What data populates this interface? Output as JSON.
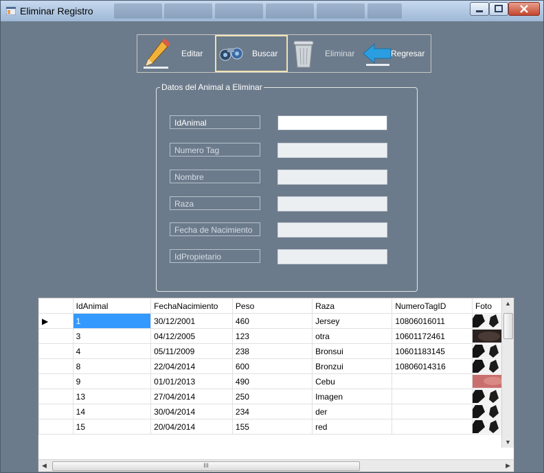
{
  "window": {
    "title": "Eliminar Registro",
    "icon": "form-icon"
  },
  "toolbar": [
    {
      "label": "Editar",
      "icon": "pencil-icon"
    },
    {
      "label": "Buscar",
      "icon": "binoculars-icon"
    },
    {
      "label": "Eliminar",
      "icon": "trash-icon"
    },
    {
      "label": "Regresar",
      "icon": "arrow-left-icon"
    }
  ],
  "group": {
    "title": "Datos del Animal a Eliminar",
    "fields": [
      {
        "label": "IdAnimal",
        "value": ""
      },
      {
        "label": "Numero Tag",
        "value": ""
      },
      {
        "label": "Nombre",
        "value": ""
      },
      {
        "label": "Raza",
        "value": ""
      },
      {
        "label": "Fecha de Nacimiento",
        "value": ""
      },
      {
        "label": "IdPropietario",
        "value": ""
      }
    ]
  },
  "grid": {
    "columns": [
      "IdAnimal",
      "FechaNacimiento",
      "Peso",
      "Raza",
      "NumeroTagID",
      "Foto"
    ],
    "rows": [
      [
        "1",
        "30/12/2001",
        "460",
        "Jersey",
        "10806016011",
        "photo-cow"
      ],
      [
        "3",
        "04/12/2005",
        "123",
        "otra",
        "10601172461",
        "photo-dark"
      ],
      [
        "4",
        "05/11/2009",
        "238",
        "Bronsui",
        "10601183145",
        "photo-cow"
      ],
      [
        "8",
        "22/04/2014",
        "600",
        "Bronzui",
        "10806014316",
        "photo-cow"
      ],
      [
        "9",
        "01/01/2013",
        "490",
        "Cebu",
        "",
        "photo-pink"
      ],
      [
        "13",
        "27/04/2014",
        "250",
        "Imagen",
        "",
        "photo-cow"
      ],
      [
        "14",
        "30/04/2014",
        "234",
        "der",
        "",
        "photo-cow"
      ],
      [
        "15",
        "20/04/2014",
        "155",
        "red",
        "",
        "photo-cow"
      ]
    ],
    "current_row_marker": "▶",
    "scrollbar_thumb_label": "III"
  },
  "colors": {
    "form_background": "#6c7b8b",
    "selection": "#3399ff",
    "close_button": "#c4452e"
  }
}
